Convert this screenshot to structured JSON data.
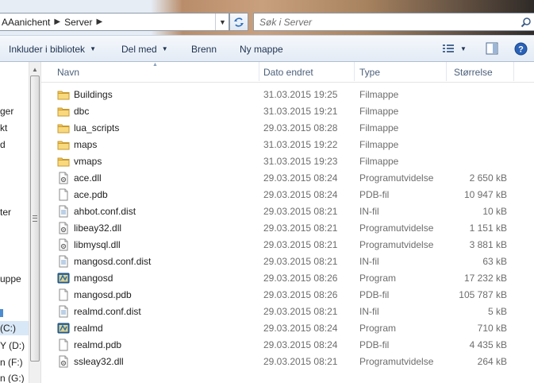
{
  "address": {
    "breadcrumb": [
      "AAanichent",
      "Server"
    ],
    "search_placeholder": "Søk i Server"
  },
  "toolbar": {
    "include_library": "Inkluder i bibliotek",
    "share_with": "Del med",
    "burn": "Brenn",
    "new_folder": "Ny mappe"
  },
  "nav": {
    "items": [
      "ger",
      "kt",
      "d",
      "ter",
      "uppe",
      "(C:)",
      "Y (D:)",
      "n (F:)",
      "n (G:)"
    ]
  },
  "columns": {
    "name": "Navn",
    "date": "Dato endret",
    "type": "Type",
    "size": "Størrelse"
  },
  "files": [
    {
      "name": "Buildings",
      "date": "31.03.2015 19:25",
      "type": "Filmappe",
      "size": "",
      "icon": "folder-icon"
    },
    {
      "name": "dbc",
      "date": "31.03.2015 19:21",
      "type": "Filmappe",
      "size": "",
      "icon": "folder-icon"
    },
    {
      "name": "lua_scripts",
      "date": "29.03.2015 08:28",
      "type": "Filmappe",
      "size": "",
      "icon": "folder-icon"
    },
    {
      "name": "maps",
      "date": "31.03.2015 19:22",
      "type": "Filmappe",
      "size": "",
      "icon": "folder-icon"
    },
    {
      "name": "vmaps",
      "date": "31.03.2015 19:23",
      "type": "Filmappe",
      "size": "",
      "icon": "folder-icon"
    },
    {
      "name": "ace.dll",
      "date": "29.03.2015 08:24",
      "type": "Programutvidelse",
      "size": "2 650 kB",
      "icon": "dll-file-icon"
    },
    {
      "name": "ace.pdb",
      "date": "29.03.2015 08:24",
      "type": "PDB-fil",
      "size": "10 947 kB",
      "icon": "blank-file-icon"
    },
    {
      "name": "ahbot.conf.dist",
      "date": "29.03.2015 08:21",
      "type": "IN-fil",
      "size": "10 kB",
      "icon": "text-file-icon"
    },
    {
      "name": "libeay32.dll",
      "date": "29.03.2015 08:21",
      "type": "Programutvidelse",
      "size": "1 151 kB",
      "icon": "dll-file-icon"
    },
    {
      "name": "libmysql.dll",
      "date": "29.03.2015 08:21",
      "type": "Programutvidelse",
      "size": "3 881 kB",
      "icon": "dll-file-icon"
    },
    {
      "name": "mangosd.conf.dist",
      "date": "29.03.2015 08:21",
      "type": "IN-fil",
      "size": "63 kB",
      "icon": "text-file-icon"
    },
    {
      "name": "mangosd",
      "date": "29.03.2015 08:26",
      "type": "Program",
      "size": "17 232 kB",
      "icon": "program-icon"
    },
    {
      "name": "mangosd.pdb",
      "date": "29.03.2015 08:26",
      "type": "PDB-fil",
      "size": "105 787 kB",
      "icon": "blank-file-icon"
    },
    {
      "name": "realmd.conf.dist",
      "date": "29.03.2015 08:21",
      "type": "IN-fil",
      "size": "5 kB",
      "icon": "text-file-icon"
    },
    {
      "name": "realmd",
      "date": "29.03.2015 08:24",
      "type": "Program",
      "size": "710 kB",
      "icon": "program-icon"
    },
    {
      "name": "realmd.pdb",
      "date": "29.03.2015 08:24",
      "type": "PDB-fil",
      "size": "4 435 kB",
      "icon": "blank-file-icon"
    },
    {
      "name": "ssleay32.dll",
      "date": "29.03.2015 08:21",
      "type": "Programutvidelse",
      "size": "264 kB",
      "icon": "dll-file-icon"
    }
  ],
  "colors": {
    "toolbar_text": "#1e3250",
    "column_header_text": "#4c607a",
    "secondary_text": "#6d6d6d",
    "folder_yellow": "#f2c75c",
    "help_blue": "#2a62b8"
  }
}
